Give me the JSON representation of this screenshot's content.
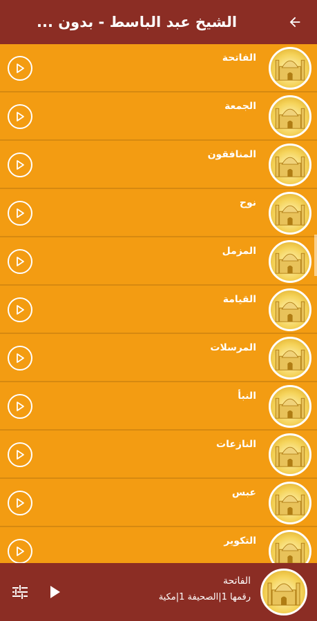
{
  "header": {
    "title": "الشيخ عبد الباسط - بدون ...",
    "back_icon": "arrow-left-icon"
  },
  "tracks": [
    {
      "name": "الفاتحة"
    },
    {
      "name": "الجمعة"
    },
    {
      "name": "المنافقون"
    },
    {
      "name": "نوح"
    },
    {
      "name": "المزمل"
    },
    {
      "name": "القيامة"
    },
    {
      "name": "المرسلات"
    },
    {
      "name": "النبأ"
    },
    {
      "name": "النازعات"
    },
    {
      "name": "عبس"
    },
    {
      "name": "التكوير"
    }
  ],
  "player": {
    "title": "الفاتحة",
    "subtitle": "رقمها 1|الصحيفة 1|مكية"
  },
  "colors": {
    "appbar": "#8b2d24",
    "row_bg": "#f39c12",
    "divider": "#d68910",
    "text": "#ffffff"
  }
}
